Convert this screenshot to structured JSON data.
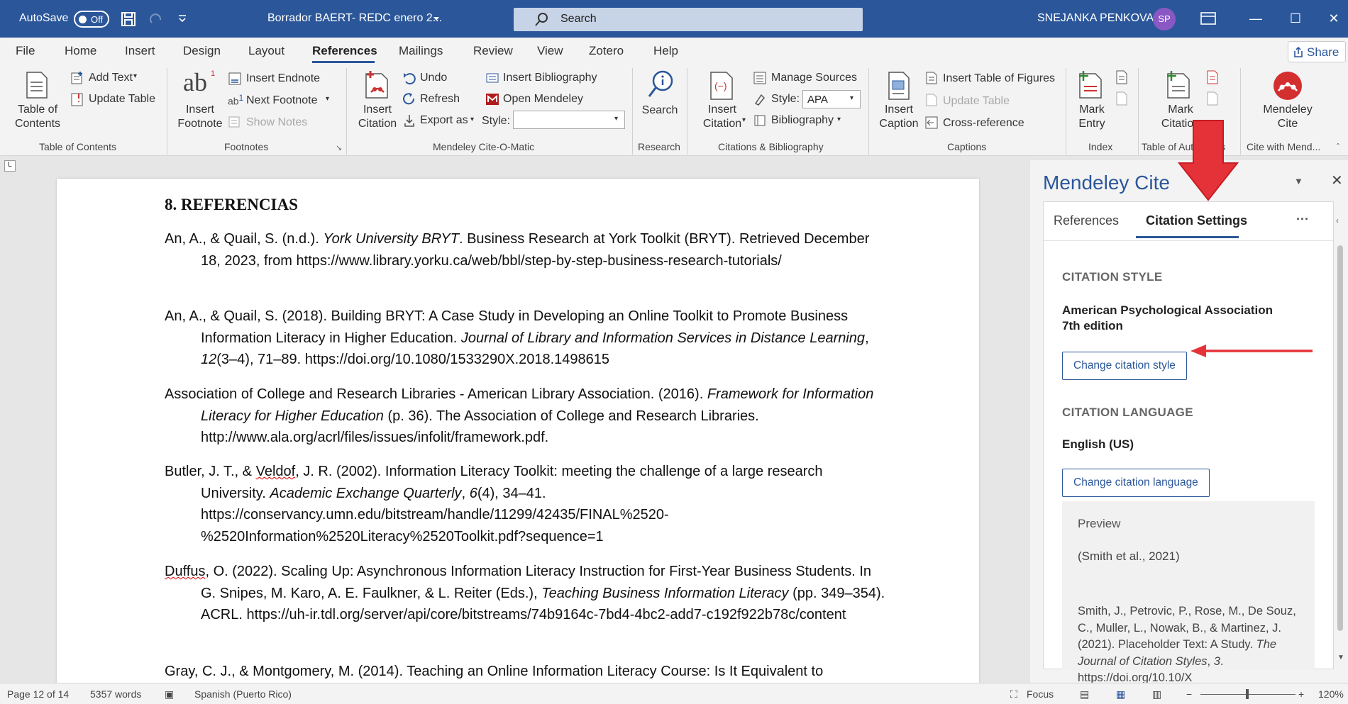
{
  "titlebar": {
    "autosave_label": "AutoSave",
    "toggle_state": "Off",
    "doc_title": "Borrador BAERT- REDC enero 2...",
    "search_label": "Search",
    "user_name": "SNEJANKA PENKOVA",
    "user_initials": "SP"
  },
  "menu_tabs": [
    "File",
    "Home",
    "Insert",
    "Design",
    "Layout",
    "References",
    "Mailings",
    "Review",
    "View",
    "Zotero",
    "Help"
  ],
  "active_tab": "References",
  "share_label": "Share",
  "ribbon": {
    "toc": {
      "big": "Table of Contents",
      "add_text": "Add Text",
      "update_table": "Update Table",
      "group": "Table of Contents"
    },
    "footnotes": {
      "big": "Insert Footnote",
      "big_icon_text": "ab",
      "insert_endnote": "Insert Endnote",
      "next_footnote": "Next Footnote",
      "show_notes": "Show Notes",
      "group": "Footnotes"
    },
    "mendeley": {
      "big": "Insert Citation",
      "undo": "Undo",
      "refresh": "Refresh",
      "export_as": "Export as",
      "insert_bibliography": "Insert Bibliography",
      "open_mendeley": "Open Mendeley",
      "style_label": "Style:",
      "style_value": "",
      "group": "Mendeley Cite-O-Matic"
    },
    "research": {
      "big": "Search",
      "group": "Research"
    },
    "citations": {
      "big": "Insert Citation",
      "manage_sources": "Manage Sources",
      "style_label": "Style:",
      "style_value": "APA",
      "bibliography": "Bibliography",
      "group": "Citations & Bibliography"
    },
    "captions": {
      "big": "Insert Caption",
      "insert_table_of_figures": "Insert Table of Figures",
      "update_table": "Update Table",
      "cross_reference": "Cross-reference",
      "group": "Captions"
    },
    "index": {
      "big": "Mark Entry",
      "group": "Index"
    },
    "toa": {
      "big": "Mark Citation",
      "group": "Table of Authorities"
    },
    "mendeley_cite": {
      "big": "Mendeley Cite",
      "group": "Cite with Mend..."
    }
  },
  "document": {
    "heading": "8.  REFERENCIAS",
    "refs": [
      {
        "parts": [
          "An, A., & Quail, S. (n.d.). ",
          [
            "York University BRYT"
          ],
          ". Business Research at York Toolkit (BRYT). Retrieved December 18, 2023, from https://www.library.yorku.ca/web/bbl/step-by-step-business-research-tutorials/"
        ]
      },
      {
        "parts": [
          "An, A., & Quail, S. (2018). Building BRYT: A Case Study in Developing an Online Toolkit to Promote Business Information Literacy in Higher Education. ",
          [
            "Journal of Library and Information Services in Distance Learning"
          ],
          ", ",
          [
            "12"
          ],
          "(3–4), 71–89. https://doi.org/10.1080/1533290X.2018.1498615"
        ]
      },
      {
        "parts": [
          "Association of College and Research Libraries - American Library Association. (2016). ",
          [
            "Framework for Information Literacy for Higher Education"
          ],
          " (p. 36). The Association of College and Research Libraries. http://www.ala.org/acrl/files/issues/infolit/framework.pdf."
        ]
      },
      {
        "parts": [
          "Butler, J. T., & ",
          {
            "sq": "Veldof"
          },
          ", J. R. (2002). Information Literacy Toolkit: meeting the challenge of a large research University. ",
          [
            "Academic Exchange Quarterly"
          ],
          ", ",
          [
            "6"
          ],
          "(4), 34–41. https://conservancy.umn.edu/bitstream/handle/11299/42435/FINAL%2520-%2520Information%2520Literacy%2520Toolkit.pdf?sequence=1"
        ]
      },
      {
        "parts": [
          {
            "sq": "Duffus"
          },
          ", O. (2022). Scaling Up: Asynchronous Information Literacy Instruction for First-Year Business Students. In G. Snipes, M. Karo, A. E. Faulkner, & L. Reiter (Eds.), ",
          [
            "Teaching Business Information Literacy"
          ],
          " (pp. 349–354). ACRL. https://uh-ir.tdl.org/server/api/core/bitstreams/74b9164c-7bd4-4bc2-add7-c192f922b78c/content"
        ]
      },
      {
        "parts": [
          "Gray, C. J., & Montgomery, M. (2014). Teaching an Online Information Literacy Course: Is It Equivalent to"
        ]
      }
    ]
  },
  "pane": {
    "title": "Mendeley Cite",
    "tab_references": "References",
    "tab_settings": "Citation Settings",
    "more": "···",
    "citation_style_header": "CITATION STYLE",
    "style_name_line1": "American Psychological Association",
    "style_name_line2": "7th edition",
    "change_style_btn": "Change citation style",
    "citation_language_header": "CITATION LANGUAGE",
    "language": "English (US)",
    "change_language_btn": "Change citation language",
    "preview_label": "Preview",
    "preview_intext": "(Smith et al., 2021)",
    "preview_ref_parts": [
      "Smith, J., Petrovic, P., Rose, M., De Souz, C., Muller, L., Nowak, B., & Martinez, J. (2021). Placeholder Text: A Study. ",
      [
        "The Journal of Citation Styles"
      ],
      ", ",
      [
        "3"
      ],
      ". https://doi.org/10.10/X"
    ]
  },
  "status": {
    "page": "Page 12 of 14",
    "words": "5357 words",
    "language": "Spanish (Puerto Rico)",
    "focus": "Focus",
    "zoom": "120%"
  },
  "colors": {
    "accent": "#2b579a",
    "annotation_arrow": "#e53238",
    "mendeley_red": "#d32f2f"
  }
}
